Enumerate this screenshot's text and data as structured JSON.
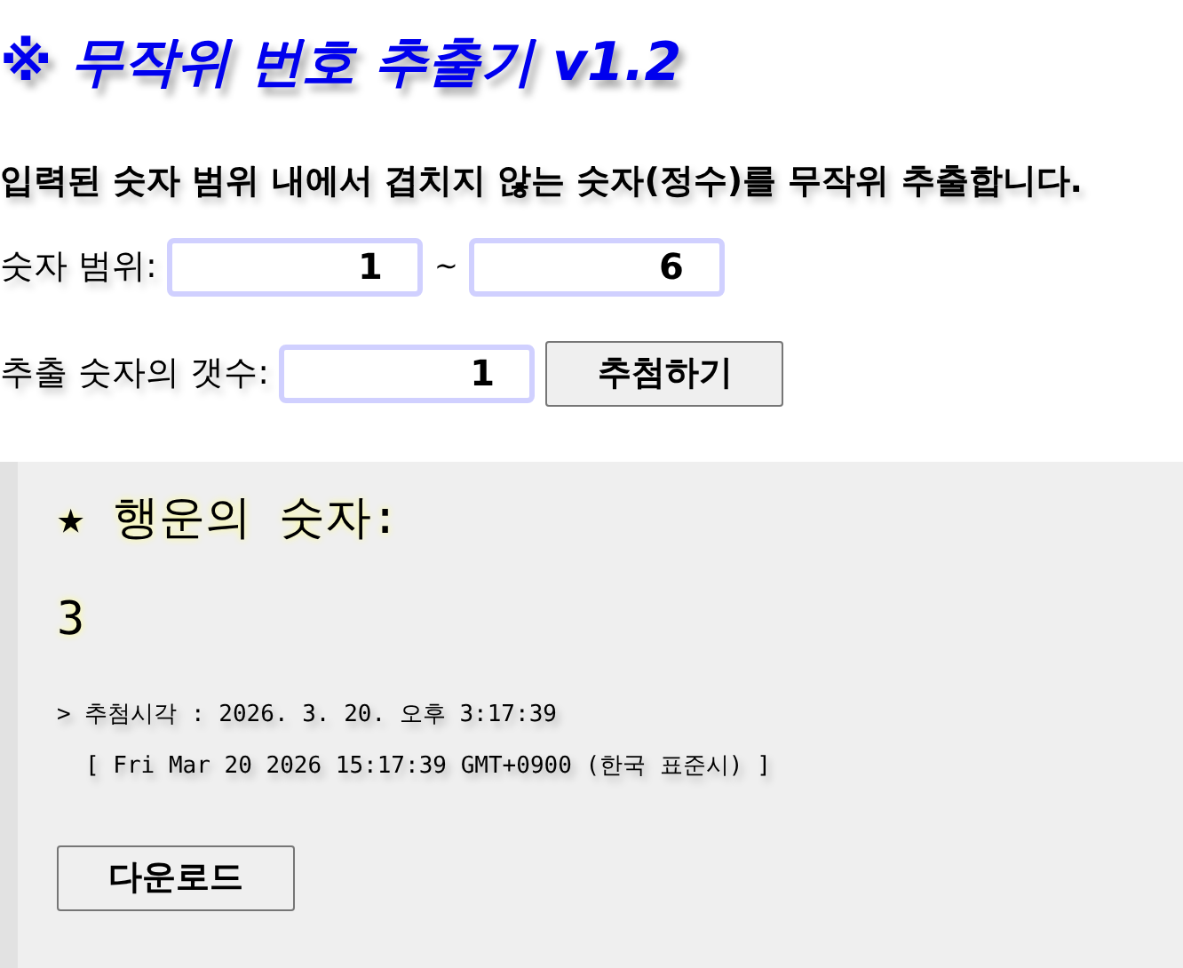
{
  "title": "※ 무작위 번호 추출기 v1.2",
  "description": "입력된 숫자 범위 내에서 겹치지 않는 숫자(정수)를 무작위 추출합니다.",
  "range": {
    "label": "숫자 범위:",
    "from": "1",
    "separator": "~",
    "to": "6"
  },
  "count": {
    "label": "추출 숫자의 갯수:",
    "value": "1",
    "button": "추첨하기"
  },
  "result": {
    "heading": "★ 행운의 숫자:",
    "numbers": "3",
    "time_line": "> 추첨시각 : 2026. 3. 20. 오후 3:17:39",
    "date_line": "[ Fri Mar 20 2026 15:17:39 GMT+0900 (한국 표준시) ]",
    "button": "다운로드"
  }
}
